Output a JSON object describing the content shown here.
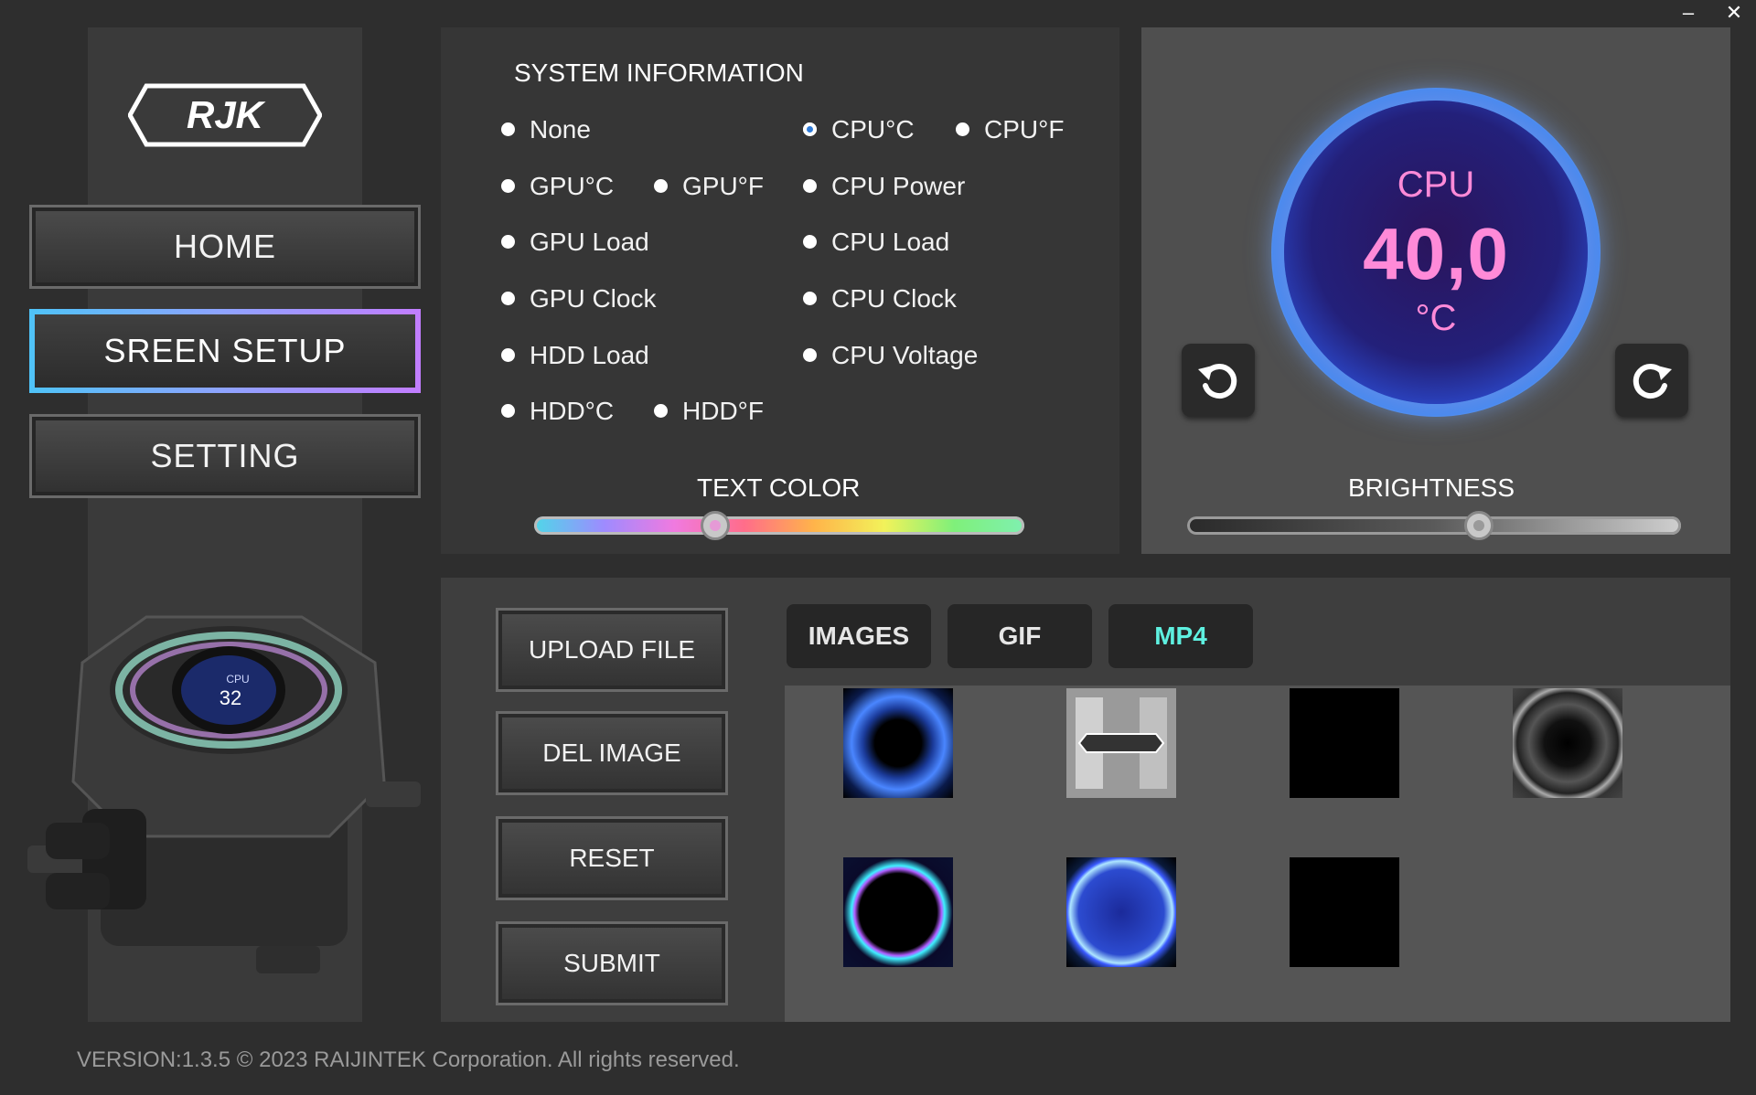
{
  "window": {
    "minimize_label": "–",
    "close_label": "✕"
  },
  "sidebar": {
    "logo_text": "RJK",
    "nav": [
      {
        "label": "HOME"
      },
      {
        "label": "SREEN  SETUP"
      },
      {
        "label": "SETTING"
      }
    ],
    "pump_display_label": "CPU",
    "pump_display_value": "32"
  },
  "system_info": {
    "title": "SYSTEM INFORMATION",
    "options": [
      {
        "label": "None",
        "selected": false
      },
      {
        "label": "CPU°C",
        "selected": true
      },
      {
        "label": "CPU°F",
        "selected": false
      },
      {
        "label": "GPU°C",
        "selected": false
      },
      {
        "label": "GPU°F",
        "selected": false
      },
      {
        "label": "CPU Power",
        "selected": false
      },
      {
        "label": "GPU Load",
        "selected": false
      },
      {
        "label": "CPU Load",
        "selected": false
      },
      {
        "label": "GPU Clock",
        "selected": false
      },
      {
        "label": "CPU Clock",
        "selected": false
      },
      {
        "label": "HDD Load",
        "selected": false
      },
      {
        "label": "CPU Voltage",
        "selected": false
      },
      {
        "label": "HDD°C",
        "selected": false
      },
      {
        "label": "HDD°F",
        "selected": false
      }
    ],
    "text_color_label": "TEXT COLOR",
    "text_color_level": 0.37
  },
  "preview": {
    "metric": "CPU",
    "value": "40,0",
    "unit": "°C",
    "brightness_label": "BRIGHTNESS",
    "brightness_level": 0.59,
    "text_color": "#ff8ad8"
  },
  "actions": {
    "upload": "UPLOAD FILE",
    "delete": "DEL IMAGE",
    "reset": "RESET",
    "submit": "SUBMIT"
  },
  "media": {
    "tabs": [
      {
        "label": "IMAGES",
        "active": false
      },
      {
        "label": "GIF",
        "active": false
      },
      {
        "label": "MP4",
        "active": true
      }
    ],
    "thumbnails": [
      {
        "kind": "blue-eye-iris"
      },
      {
        "kind": "rjk-logo-grayscale"
      },
      {
        "kind": "black"
      },
      {
        "kind": "fan-turbine"
      },
      {
        "kind": "neon-ring"
      },
      {
        "kind": "blue-energy-orb"
      },
      {
        "kind": "black"
      }
    ]
  },
  "footer": {
    "text": "VERSION:1.3.5 © 2023 RAIJINTEK Corporation. All rights reserved."
  },
  "colors": {
    "accent_tab": "#5ef0e0",
    "active_nav_gradient_start": "#4fc3f7",
    "active_nav_gradient_end": "#c27dff"
  }
}
